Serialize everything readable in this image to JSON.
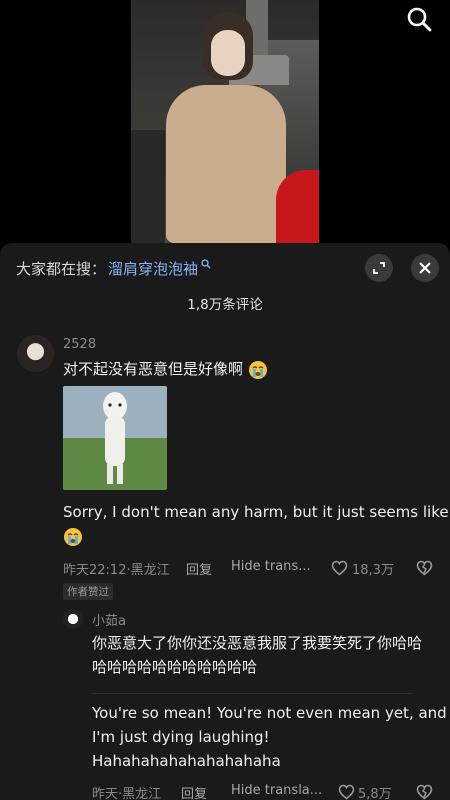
{
  "header": {
    "search_icon": "search-icon"
  },
  "sheet": {
    "search_prefix": "大家都在搜：",
    "search_keyword": "溜肩穿泡泡袖",
    "comment_count": "1,8万条评论"
  },
  "comment1": {
    "username": "2528",
    "text": "对不起没有恶意但是好像啊",
    "translation_line1": "Sorry, I don't mean any harm, but it just seems like",
    "meta_time": "昨天22:12·黑龙江",
    "reply": "回复",
    "hide_trans": "Hide trans...",
    "likes": "18,3万",
    "badge": "作者赞过"
  },
  "reply1": {
    "username": "小茹a",
    "text_line1": "你恶意大了你你还没恶意我服了我要笑死了你哈哈",
    "text_line2": "哈哈哈哈哈哈哈哈哈哈哈",
    "trans_line1": "You're so mean! You're not even mean yet, and",
    "trans_line2": "I'm just dying laughing!",
    "trans_line3": "Hahahahahahahahahaha",
    "meta_time": "昨天·黑龙江",
    "reply": "回复",
    "hide_trans": "Hide transla...",
    "likes": "5,8万"
  }
}
